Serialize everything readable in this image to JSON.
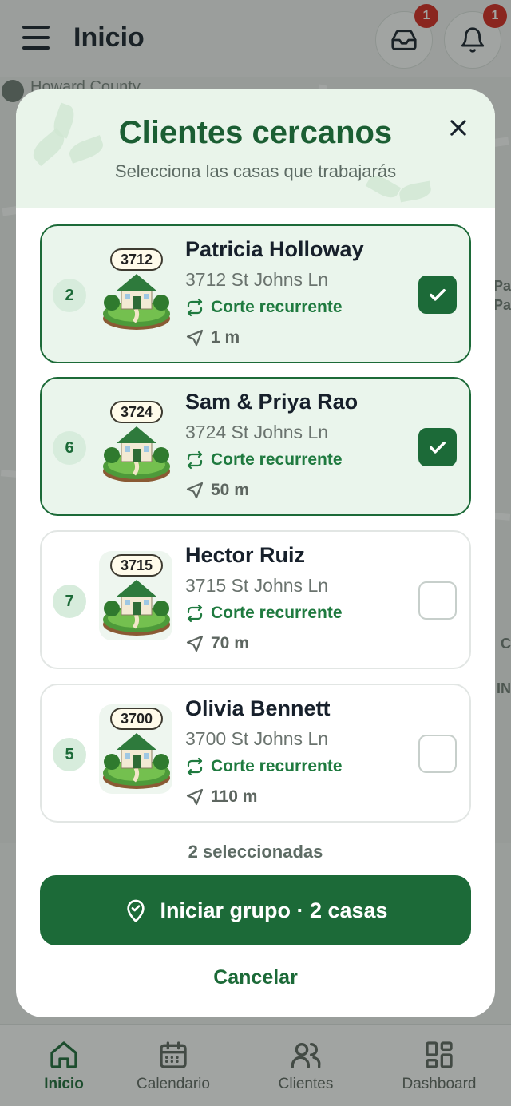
{
  "app": {
    "title": "Inicio",
    "inbox_badge": "1",
    "notifications_badge": "1",
    "map_label": "Howard County",
    "map_edge_texts": [
      "Pa",
      "Pa",
      "C",
      "IN"
    ]
  },
  "modal": {
    "title": "Clientes cercanos",
    "subtitle": "Selecciona las casas que trabajarás",
    "selected_count": "2 seleccionadas",
    "start_label": "Iniciar grupo · 2 casas",
    "cancel_label": "Cancelar"
  },
  "clients": [
    {
      "order": "2",
      "house_number": "3712",
      "name": "Patricia Holloway",
      "address": "3712 St Johns Ln",
      "service": "Corte recurrente",
      "distance": "1 m",
      "selected": true
    },
    {
      "order": "6",
      "house_number": "3724",
      "name": "Sam & Priya Rao",
      "address": "3724 St Johns Ln",
      "service": "Corte recurrente",
      "distance": "50 m",
      "selected": true
    },
    {
      "order": "7",
      "house_number": "3715",
      "name": "Hector Ruiz",
      "address": "3715 St Johns Ln",
      "service": "Corte recurrente",
      "distance": "70 m",
      "selected": false
    },
    {
      "order": "5",
      "house_number": "3700",
      "name": "Olivia Bennett",
      "address": "3700 St Johns Ln",
      "service": "Corte recurrente",
      "distance": "110 m",
      "selected": false
    }
  ],
  "nav": {
    "items": [
      {
        "label": "Inicio",
        "icon": "home-icon",
        "active": true
      },
      {
        "label": "Calendario",
        "icon": "calendar-icon",
        "active": false
      },
      {
        "label": "Clientes",
        "icon": "users-icon",
        "active": false
      },
      {
        "label": "Dashboard",
        "icon": "dashboard-icon",
        "active": false
      }
    ]
  },
  "colors": {
    "primary": "#1c6a38",
    "selected_card_bg": "#eaf5ec",
    "badge_red": "#d7261e",
    "header_bg": "#e9f4ea"
  }
}
